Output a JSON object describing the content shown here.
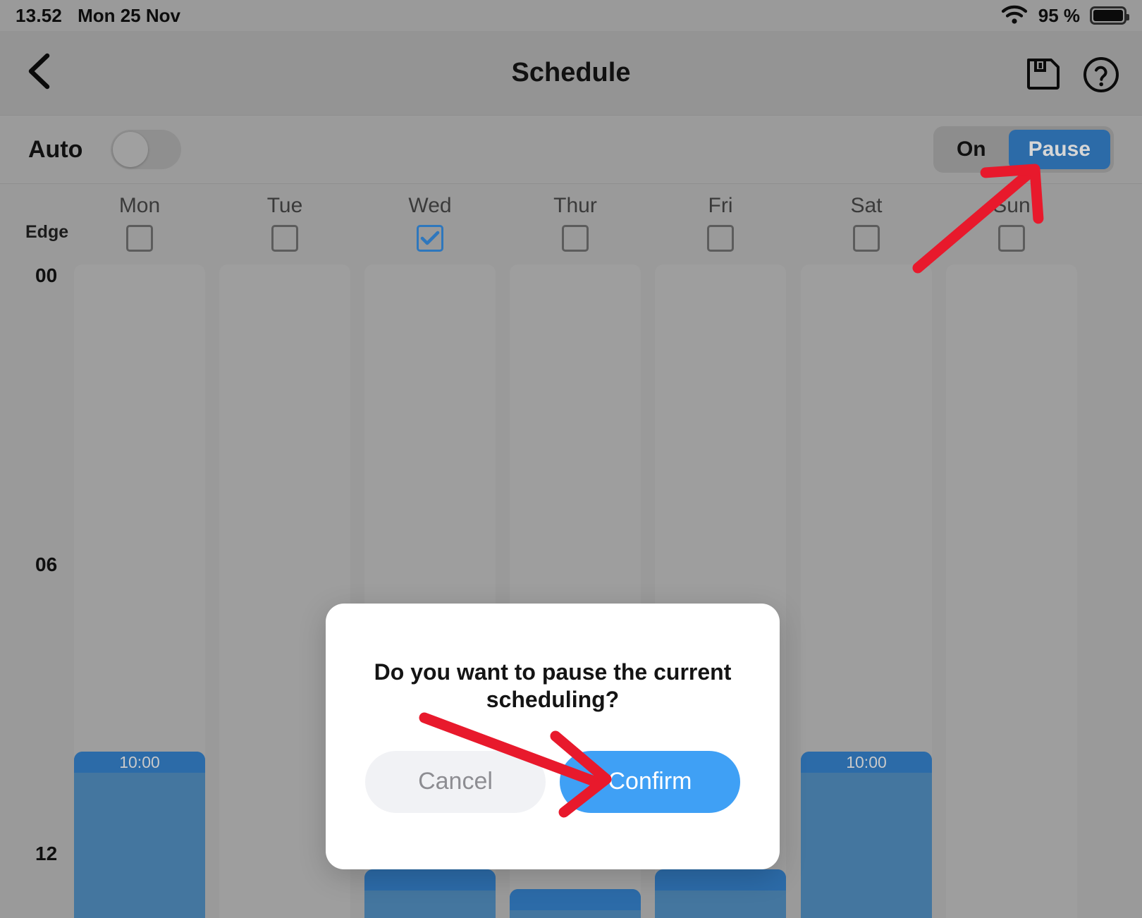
{
  "statusbar": {
    "time": "13.52",
    "date": "Mon 25 Nov",
    "battery_percent": "95 %",
    "wifi_icon": "wifi-icon",
    "battery_icon": "battery-full-icon"
  },
  "navbar": {
    "back_icon": "chevron-left-icon",
    "title": "Schedule",
    "save_icon": "floppy-save-icon",
    "help_icon": "question-circle-icon"
  },
  "controls": {
    "auto_label": "Auto",
    "auto_toggle_state": "off",
    "mode_options": [
      "On",
      "Pause"
    ],
    "mode_selected": "Pause",
    "selected_color": "#2c6ba8"
  },
  "schedule": {
    "edge_label": "Edge",
    "days": [
      {
        "label": "Mon",
        "checked": false
      },
      {
        "label": "Tue",
        "checked": false
      },
      {
        "label": "Wed",
        "checked": true
      },
      {
        "label": "Thur",
        "checked": false
      },
      {
        "label": "Fri",
        "checked": false
      },
      {
        "label": "Sat",
        "checked": false
      },
      {
        "label": "Sun",
        "checked": false
      }
    ],
    "time_labels": [
      "00",
      "06",
      "12"
    ],
    "blocks": [
      {
        "day": "Mon",
        "start_time": "10:00"
      },
      {
        "day": "Wed",
        "start_time": ""
      },
      {
        "day": "Thur",
        "start_time": ""
      },
      {
        "day": "Fri",
        "start_time": ""
      },
      {
        "day": "Sat",
        "start_time": "10:00"
      }
    ],
    "block_color": "#44769f",
    "block_header_color": "#2c6ba8"
  },
  "dialog": {
    "message": "Do you want to pause the current scheduling?",
    "cancel_label": "Cancel",
    "confirm_label": "Confirm",
    "confirm_color": "#3fa0f5"
  },
  "annotations": {
    "arrow_color": "#e8192c",
    "arrow_to_pause": "arrow-pointing-to-pause-button",
    "arrow_to_confirm": "arrow-pointing-to-confirm-button"
  }
}
